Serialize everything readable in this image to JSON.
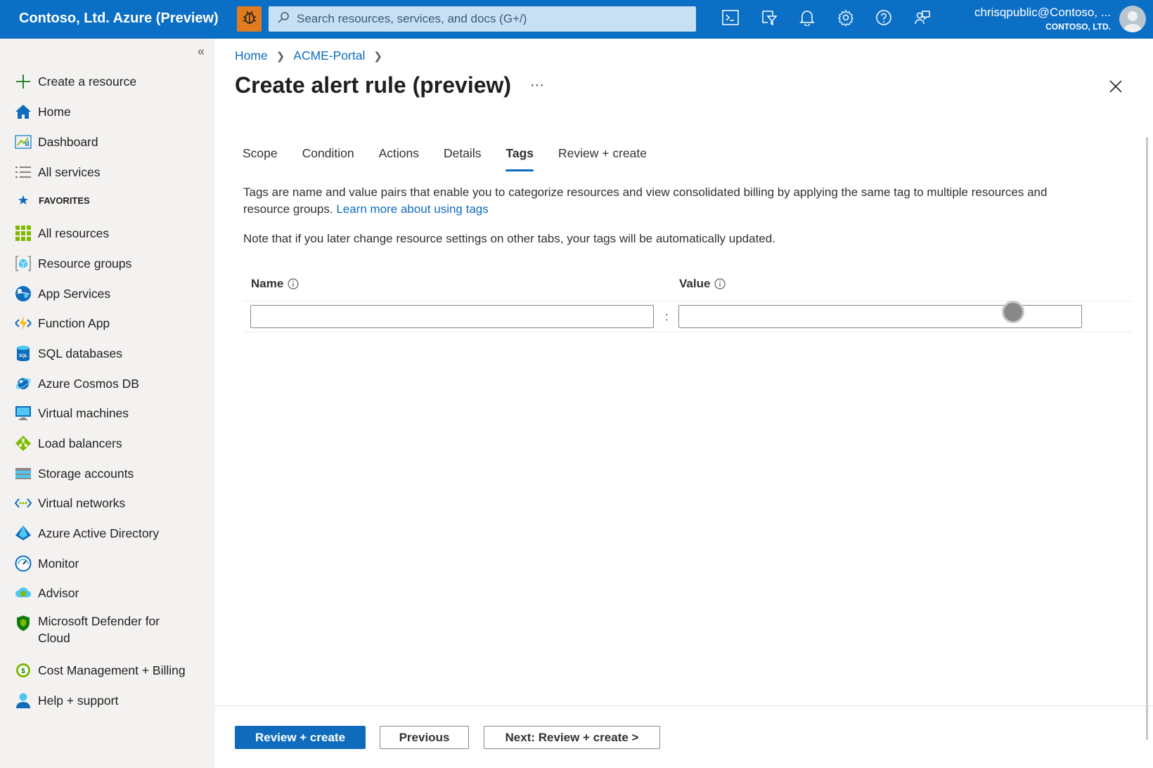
{
  "topbar": {
    "brand": "Contoso, Ltd. Azure (Preview)",
    "search_placeholder": "Search resources, services, and docs (G+/)",
    "account_email": "chrisqpublic@Contoso, ...",
    "account_org": "CONTOSO, LTD.",
    "icons": [
      "bug-icon",
      "cloud-shell-icon",
      "directory-filter-icon",
      "bell-icon",
      "gear-icon",
      "help-icon",
      "feedback-icon"
    ]
  },
  "sidebar": {
    "collapse_glyph": "«",
    "favorites_label": "FAVORITES",
    "top_items": [
      {
        "label": "Create a resource",
        "icon": "plus-icon"
      },
      {
        "label": "Home",
        "icon": "home-icon"
      },
      {
        "label": "Dashboard",
        "icon": "dashboard-icon"
      },
      {
        "label": "All services",
        "icon": "list-icon"
      }
    ],
    "favorite_items": [
      {
        "label": "All resources",
        "icon": "grid-icon"
      },
      {
        "label": "Resource groups",
        "icon": "resource-group-icon"
      },
      {
        "label": "App Services",
        "icon": "app-services-icon"
      },
      {
        "label": "Function App",
        "icon": "function-app-icon"
      },
      {
        "label": "SQL databases",
        "icon": "sql-icon"
      },
      {
        "label": "Azure Cosmos DB",
        "icon": "cosmos-icon"
      },
      {
        "label": "Virtual machines",
        "icon": "vm-icon"
      },
      {
        "label": "Load balancers",
        "icon": "load-balancer-icon"
      },
      {
        "label": "Storage accounts",
        "icon": "storage-icon"
      },
      {
        "label": "Virtual networks",
        "icon": "vnet-icon"
      },
      {
        "label": "Azure Active Directory",
        "icon": "aad-icon"
      },
      {
        "label": "Monitor",
        "icon": "monitor-icon"
      },
      {
        "label": "Advisor",
        "icon": "advisor-icon"
      },
      {
        "label": "Microsoft Defender for",
        "label2": "Cloud",
        "icon": "defender-icon"
      },
      {
        "label": "Cost Management + Billing",
        "icon": "cost-icon"
      },
      {
        "label": "Help + support",
        "icon": "help-support-icon"
      }
    ]
  },
  "main": {
    "breadcrumb": [
      "Home",
      "ACME-Portal"
    ],
    "title": "Create alert rule (preview)",
    "more_glyph": "···",
    "tabs": [
      {
        "label": "Scope",
        "active": false
      },
      {
        "label": "Condition",
        "active": false
      },
      {
        "label": "Actions",
        "active": false
      },
      {
        "label": "Details",
        "active": false
      },
      {
        "label": "Tags",
        "active": true
      },
      {
        "label": "Review + create",
        "active": false
      }
    ],
    "description": "Tags are name and value pairs that enable you to categorize resources and view consolidated billing by applying the same tag to multiple resources and resource groups.",
    "learn_more": "Learn more about using tags",
    "note": "Note that if you later change resource settings on other tabs, your tags will be automatically updated.",
    "name_header": "Name",
    "value_header": "Value",
    "name_value": "",
    "value_value": "",
    "colon": ":"
  },
  "footer": {
    "review_create": "Review + create",
    "previous": "Previous",
    "next": "Next: Review + create >"
  },
  "colors": {
    "topbar": "#0c6fc6",
    "accent": "#0f6cbd",
    "bug_button": "#e07b1f"
  }
}
